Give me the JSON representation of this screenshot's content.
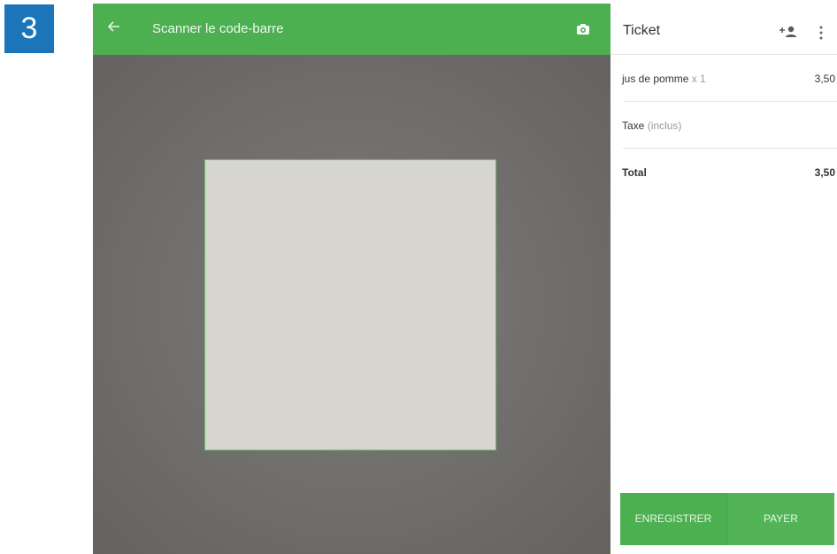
{
  "step_badge": "3",
  "scanner": {
    "title": "Scanner le code-barre",
    "back_icon": "arrow-left-icon",
    "camera_icon": "camera-switch-icon"
  },
  "ticket": {
    "title": "Ticket",
    "add_customer_icon": "add-customer-icon",
    "menu_icon": "more-vertical-icon",
    "items": [
      {
        "name": "jus de pomme",
        "qty": "x 1",
        "amount": "3,50"
      }
    ],
    "tax": {
      "label": "Taxe",
      "note": "(inclus)"
    },
    "total": {
      "label": "Total",
      "amount": "3,50"
    },
    "save_label": "ENREGISTRER",
    "pay_label": "PAYER"
  },
  "colors": {
    "accent": "#4caf50",
    "badge": "#1b75b8"
  }
}
